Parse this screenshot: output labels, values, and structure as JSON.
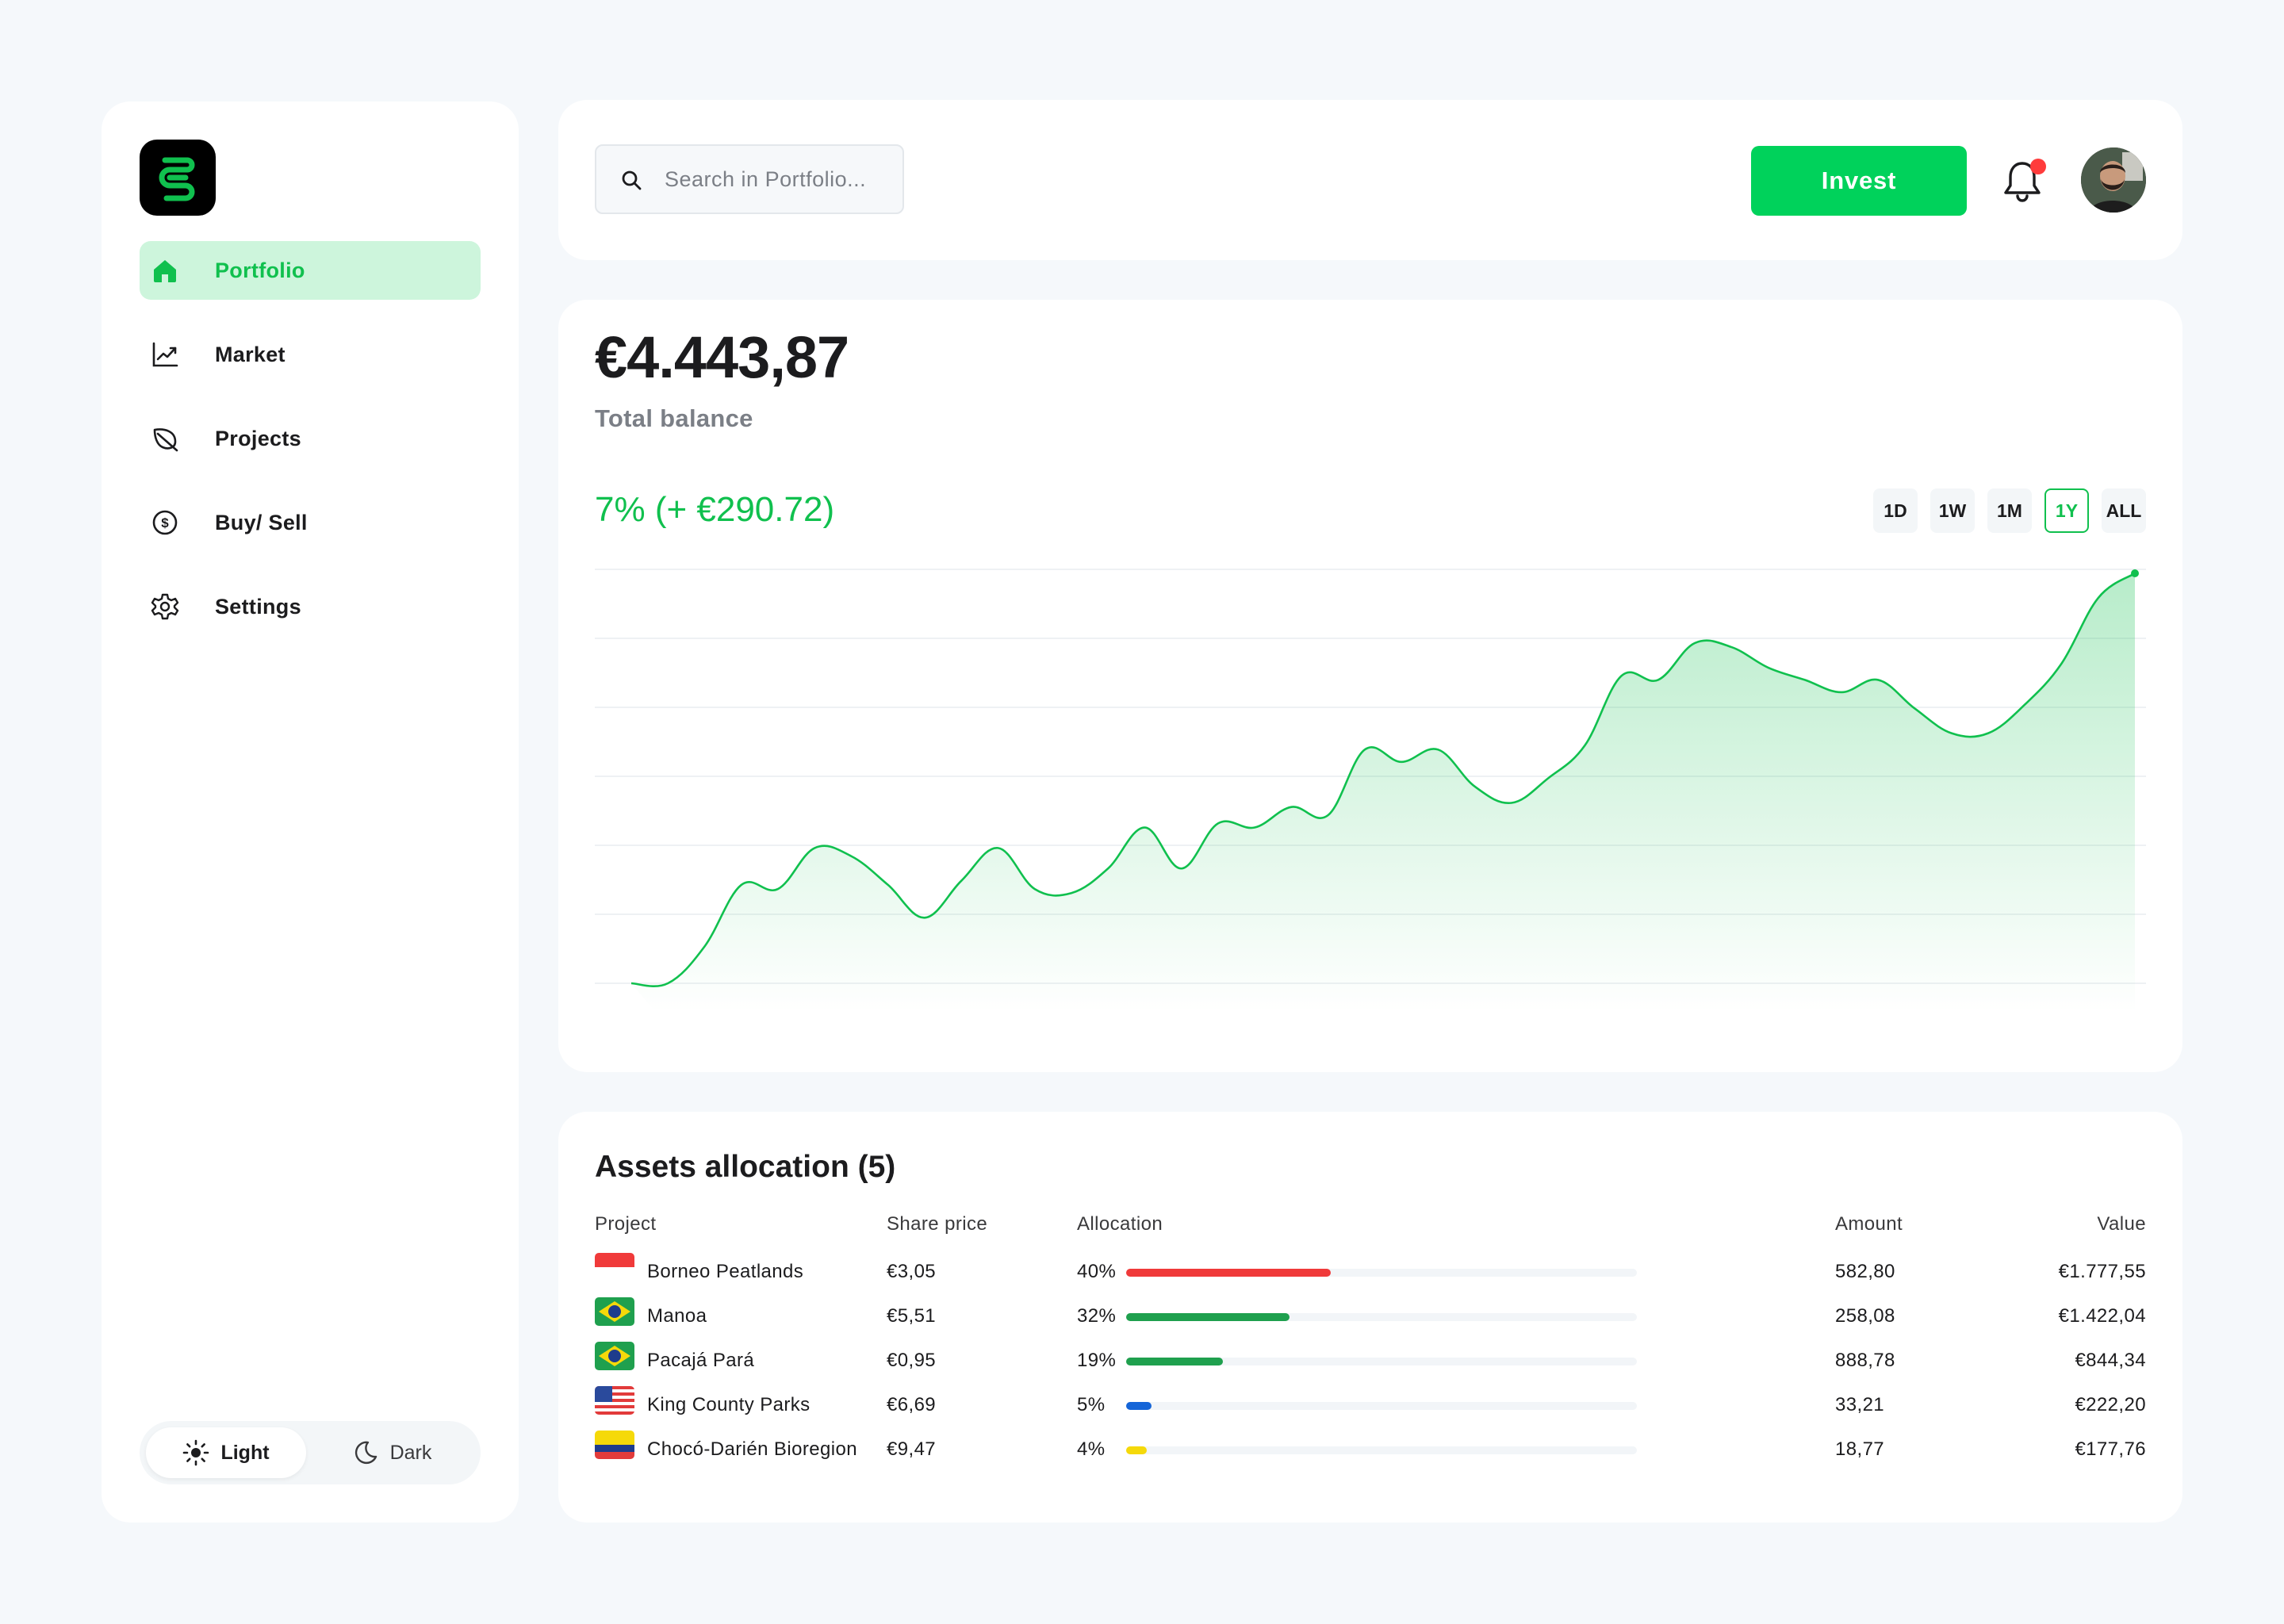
{
  "sidebar": {
    "logo_icon": "brand-logo-icon",
    "items": [
      {
        "label": "Portfolio",
        "icon": "home-icon",
        "active": true
      },
      {
        "label": "Market",
        "icon": "line-chart-icon",
        "active": false
      },
      {
        "label": "Projects",
        "icon": "leaf-icon",
        "active": false
      },
      {
        "label": "Buy/ Sell",
        "icon": "dollar-circle-icon",
        "active": false
      },
      {
        "label": "Settings",
        "icon": "gear-icon",
        "active": false
      }
    ],
    "theme": {
      "light_label": "Light",
      "dark_label": "Dark",
      "selected": "Light"
    }
  },
  "header": {
    "search_placeholder": "Search in Portfolio...",
    "invest_label": "Invest",
    "notification_badge": true
  },
  "balance": {
    "amount": "€4.443,87",
    "label": "Total balance",
    "change": "7% (+ €290.72)",
    "ranges": [
      "1D",
      "1W",
      "1M",
      "1Y",
      "ALL"
    ],
    "selected_range": "1Y"
  },
  "chart_data": {
    "type": "area",
    "values": [
      0,
      0,
      9,
      24,
      23,
      33,
      31,
      24,
      16,
      25,
      33,
      23,
      22,
      28,
      38,
      28,
      39,
      38,
      43,
      41,
      57,
      54,
      57,
      48,
      44,
      50,
      58,
      75,
      74,
      83,
      82,
      77,
      74,
      71,
      74,
      67,
      61,
      61,
      68,
      78,
      94,
      100
    ],
    "grid": true,
    "color": "#10c04e"
  },
  "assets": {
    "title": "Assets allocation (5)",
    "columns": {
      "project": "Project",
      "share_price": "Share price",
      "allocation": "Allocation",
      "amount": "Amount",
      "value": "Value"
    },
    "rows": [
      {
        "flag": "indonesia",
        "project": "Borneo Peatlands",
        "share_price": "€3,05",
        "allocation": "40%",
        "allocation_pct": 40,
        "color": "#f03a3a",
        "amount": "582,80",
        "value": "€1.777,55"
      },
      {
        "flag": "brazil",
        "project": "Manoa",
        "share_price": "€5,51",
        "allocation": "32%",
        "allocation_pct": 32,
        "color": "#1fa04e",
        "amount": "258,08",
        "value": "€1.422,04"
      },
      {
        "flag": "brazil",
        "project": "Pacajá Pará",
        "share_price": "€0,95",
        "allocation": "19%",
        "allocation_pct": 19,
        "color": "#1fa04e",
        "amount": "888,78",
        "value": "€844,34"
      },
      {
        "flag": "usa",
        "project": "King County Parks",
        "share_price": "€6,69",
        "allocation": "5%",
        "allocation_pct": 5,
        "color": "#1565d8",
        "amount": "33,21",
        "value": "€222,20"
      },
      {
        "flag": "colombia",
        "project": "Chocó-Darién Bioregion",
        "share_price": "€9,47",
        "allocation": "4%",
        "allocation_pct": 4,
        "color": "#f5d90a",
        "amount": "18,77",
        "value": "€177,76"
      }
    ]
  }
}
